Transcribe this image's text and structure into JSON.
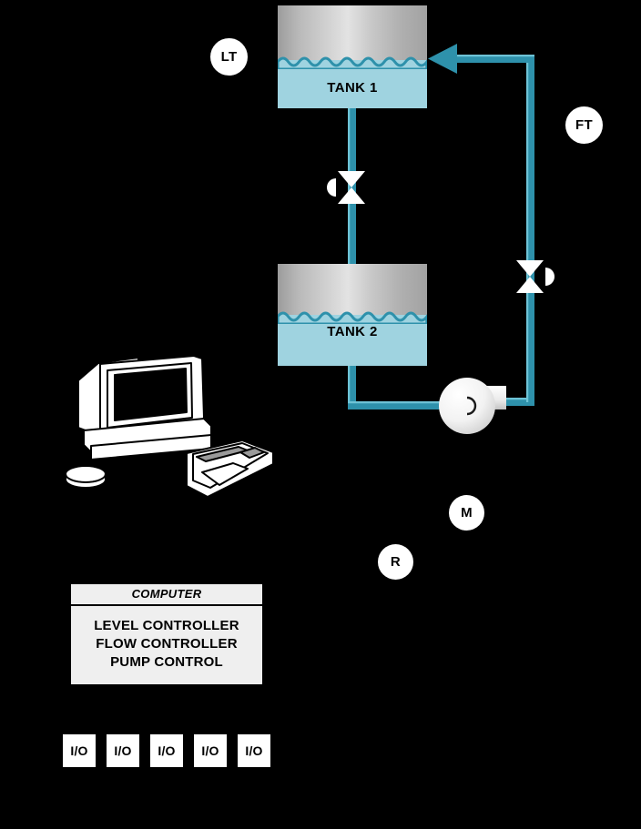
{
  "diagram": {
    "title": "Two-tank level and flow control process diagram",
    "colors": {
      "background": "#000000",
      "pipe": "#2e91ab",
      "pipe_highlight": "#6ec3d6",
      "water": "#9fd3e0",
      "tank_shell_light": "#e3e3e3",
      "tank_shell_dark": "#9c9c9c",
      "bubble_fill": "#ffffff",
      "valve_fill": "#ffffff",
      "box_fill": "#efefef",
      "line": "#000000"
    }
  },
  "tanks": [
    {
      "id": "tank-1",
      "label": "TANK 1"
    },
    {
      "id": "tank-2",
      "label": "TANK 2"
    }
  ],
  "instruments": [
    {
      "id": "lt",
      "tag": "LT",
      "name": "level-transmitter-bubble"
    },
    {
      "id": "ft",
      "tag": "FT",
      "name": "flow-transmitter-bubble"
    },
    {
      "id": "m",
      "tag": "M",
      "name": "motor-bubble"
    },
    {
      "id": "r",
      "tag": "R",
      "name": "relay-bubble"
    }
  ],
  "valves": [
    {
      "id": "valve-1",
      "name": "control-valve-tank1-outlet",
      "actuator_side": "left"
    },
    {
      "id": "valve-2",
      "name": "control-valve-discharge",
      "actuator_side": "right"
    }
  ],
  "pump": {
    "id": "pump-1",
    "name": "centrifugal-pump"
  },
  "workstation": {
    "name": "operator-workstation"
  },
  "control_box": {
    "header": "COMPUTER",
    "lines": [
      "LEVEL CONTROLLER",
      "FLOW CONTROLLER",
      "PUMP CONTROL"
    ]
  },
  "io_modules": [
    {
      "label": "I/O"
    },
    {
      "label": "I/O"
    },
    {
      "label": "I/O"
    },
    {
      "label": "I/O"
    },
    {
      "label": "I/O"
    }
  ]
}
